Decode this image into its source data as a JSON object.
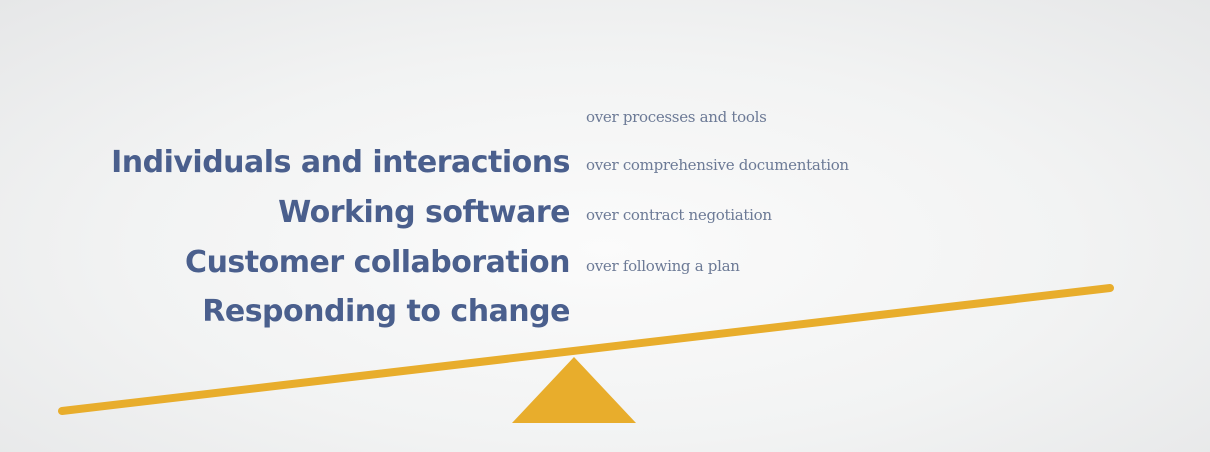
{
  "manifesto": {
    "preferred": [
      "Individuals and interactions",
      "Working software",
      "Customer collaboration",
      "Responding to change"
    ],
    "over": [
      "over processes and tools",
      "over comprehensive documentation",
      "over contract negotiation",
      "over following a plan"
    ]
  },
  "colors": {
    "beam": "#e8ad2c",
    "fulcrum": "#e8ad2c",
    "preferred_text": "#4a5f8d",
    "over_text": "#6c7a96"
  }
}
